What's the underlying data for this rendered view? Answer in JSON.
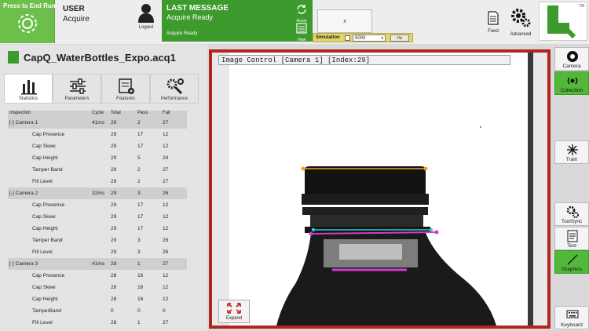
{
  "toolbar": {
    "run_label": "Press to End Run",
    "user_heading": "USER",
    "user_name": "Acquire",
    "logout_label": "Logout",
    "last_message_heading": "LAST MESSAGE",
    "last_message": "Acquire Ready",
    "last_message_footer": "Acquire Ready",
    "reset_label": "Reset",
    "view_label": "View",
    "x_box_label": "x",
    "simulation_label": "Simulation",
    "simulation_value": "5000",
    "simulation_button": "Hz",
    "feed_label": "Feed",
    "advanced_label": "Advanced",
    "logo_tm": "TM"
  },
  "file_name": "CapQ_WaterBottles_Expo.acq1",
  "tabs": [
    {
      "label": "Statistics",
      "icon": "bar-chart-icon"
    },
    {
      "label": "Parameters",
      "icon": "sliders-icon"
    },
    {
      "label": "Features",
      "icon": "features-icon"
    },
    {
      "label": "Performance",
      "icon": "wrench-gear-icon"
    }
  ],
  "table": {
    "headers": {
      "inspection": "Inspection",
      "cycle": "Cycle",
      "total": "Total",
      "pass": "Pass",
      "fail": "Fail"
    },
    "rows": [
      {
        "name": "[-] Camera 1",
        "cycle": "41ms",
        "total": "29",
        "pass": "2",
        "fail": "27",
        "camera": true
      },
      {
        "name": "Cap Presence",
        "cycle": "",
        "total": "29",
        "pass": "17",
        "fail": "12"
      },
      {
        "name": "Cap Skew",
        "cycle": "",
        "total": "29",
        "pass": "17",
        "fail": "12"
      },
      {
        "name": "Cap Height",
        "cycle": "",
        "total": "29",
        "pass": "5",
        "fail": "24"
      },
      {
        "name": "Tamper Band",
        "cycle": "",
        "total": "29",
        "pass": "2",
        "fail": "27"
      },
      {
        "name": "Fill Level",
        "cycle": "",
        "total": "29",
        "pass": "2",
        "fail": "27"
      },
      {
        "name": "[-] Camera 2",
        "cycle": "32ms",
        "total": "29",
        "pass": "3",
        "fail": "26",
        "camera": true
      },
      {
        "name": "Cap Presence",
        "cycle": "",
        "total": "29",
        "pass": "17",
        "fail": "12"
      },
      {
        "name": "Cap Skew",
        "cycle": "",
        "total": "29",
        "pass": "17",
        "fail": "12"
      },
      {
        "name": "Cap Height",
        "cycle": "",
        "total": "29",
        "pass": "17",
        "fail": "12"
      },
      {
        "name": "Tamper Band",
        "cycle": "",
        "total": "29",
        "pass": "3",
        "fail": "26"
      },
      {
        "name": "Fill Level",
        "cycle": "",
        "total": "29",
        "pass": "3",
        "fail": "26"
      },
      {
        "name": "[-] Camera 3",
        "cycle": "41ms",
        "total": "28",
        "pass": "1",
        "fail": "27",
        "camera": true
      },
      {
        "name": "Cap Presence",
        "cycle": "",
        "total": "28",
        "pass": "16",
        "fail": "12"
      },
      {
        "name": "Cap Skew",
        "cycle": "",
        "total": "28",
        "pass": "16",
        "fail": "12"
      },
      {
        "name": "Cap Height",
        "cycle": "",
        "total": "28",
        "pass": "16",
        "fail": "12"
      },
      {
        "name": "TamperBand",
        "cycle": "",
        "total": "0",
        "pass": "0",
        "fail": "0"
      },
      {
        "name": "Fill Level",
        "cycle": "",
        "total": "28",
        "pass": "1",
        "fail": "27"
      }
    ]
  },
  "image_control": {
    "title": "Image Control [Camera 1] [Index:29]",
    "expand_label": "Expand"
  },
  "right_panel": [
    {
      "label": "Camera",
      "icon": "camera-icon",
      "active": false
    },
    {
      "label": "Collection",
      "icon": "collection-icon",
      "active": true
    },
    {
      "label": "Train",
      "icon": "train-icon",
      "active": false
    },
    {
      "label": "ToolSync",
      "icon": "toolsync-icon",
      "active": false
    },
    {
      "label": "Text",
      "icon": "text-icon",
      "active": false
    },
    {
      "label": "Graphics",
      "icon": "graphics-icon",
      "active": true
    },
    {
      "label": "Keyboard",
      "icon": "keyboard-icon",
      "active": false
    }
  ],
  "colors": {
    "accent_green": "#3d9a2c",
    "run_green": "#6cbf4a",
    "border_red": "#b3231f",
    "sim_yellow": "#e3d56a"
  }
}
